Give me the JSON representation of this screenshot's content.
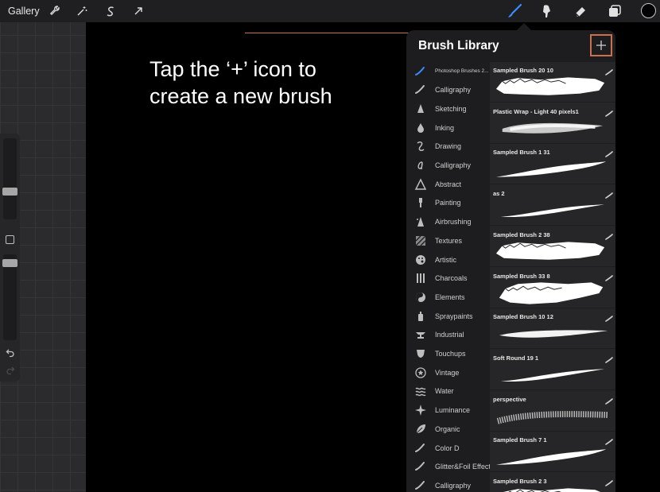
{
  "toolbar": {
    "gallery_label": "Gallery",
    "left_tools": [
      {
        "icon": "wrench-icon"
      },
      {
        "icon": "magic-wand-icon"
      },
      {
        "icon": "selection-icon"
      },
      {
        "icon": "transform-arrow-icon"
      }
    ],
    "right_tools": [
      {
        "icon": "brush-icon",
        "active": true
      },
      {
        "icon": "smudge-icon"
      },
      {
        "icon": "eraser-icon"
      },
      {
        "icon": "layers-icon"
      }
    ],
    "accent_color": "#3a8dff",
    "current_color": "#000000"
  },
  "callout": {
    "text": "Tap the ‘+’ icon to\ncreate a new brush",
    "highlight_color": "#c8704f"
  },
  "brush_library": {
    "title": "Brush Library",
    "add_icon": "plus-icon",
    "categories": [
      {
        "label": "Photoshop Brushes 2...",
        "icon": "brush-stroke-icon",
        "selected": true
      },
      {
        "label": "Calligraphy",
        "icon": "brush-stroke-icon"
      },
      {
        "label": "Sketching",
        "icon": "pencil-tip-icon"
      },
      {
        "label": "Inking",
        "icon": "ink-drop-icon"
      },
      {
        "label": "Drawing",
        "icon": "squiggle-icon"
      },
      {
        "label": "Calligraphy",
        "icon": "script-a-icon"
      },
      {
        "label": "Abstract",
        "icon": "triangle-icon"
      },
      {
        "label": "Painting",
        "icon": "paintbrush-icon"
      },
      {
        "label": "Airbrushing",
        "icon": "airbrush-icon"
      },
      {
        "label": "Textures",
        "icon": "hatch-icon"
      },
      {
        "label": "Artistic",
        "icon": "palette-icon"
      },
      {
        "label": "Charcoals",
        "icon": "charcoal-icon"
      },
      {
        "label": "Elements",
        "icon": "yin-yang-icon"
      },
      {
        "label": "Spraypaints",
        "icon": "spray-can-icon"
      },
      {
        "label": "Industrial",
        "icon": "anvil-icon"
      },
      {
        "label": "Touchups",
        "icon": "shield-icon"
      },
      {
        "label": "Vintage",
        "icon": "star-badge-icon"
      },
      {
        "label": "Water",
        "icon": "waves-icon"
      },
      {
        "label": "Luminance",
        "icon": "sparkle-icon"
      },
      {
        "label": "Organic",
        "icon": "leaf-icon"
      },
      {
        "label": "Color D",
        "icon": "brush-stroke-icon"
      },
      {
        "label": "Glitter&Foil Effects",
        "icon": "brush-stroke-icon"
      },
      {
        "label": "Calligraphy",
        "icon": "brush-stroke-icon"
      }
    ],
    "brushes": [
      {
        "name": "Sampled Brush 20 10",
        "stroke": "rough-wide"
      },
      {
        "name": "Plastic Wrap - Light 40 pixels1",
        "stroke": "soft-wide"
      },
      {
        "name": "Sampled Brush 1 31",
        "stroke": "tapered-rough"
      },
      {
        "name": "as 2",
        "stroke": "smooth-taper"
      },
      {
        "name": "Sampled Brush 2 38",
        "stroke": "rough-wide"
      },
      {
        "name": "Sampled Brush 33 8",
        "stroke": "rough-blob"
      },
      {
        "name": "Sampled Brush 10 12",
        "stroke": "soft-taper"
      },
      {
        "name": "Soft Round 19 1",
        "stroke": "smooth-taper"
      },
      {
        "name": "perspective",
        "stroke": "dotted"
      },
      {
        "name": "Sampled Brush 7 1",
        "stroke": "tapered-rough"
      },
      {
        "name": "Sampled Brush 2 3",
        "stroke": "rough-wide"
      }
    ]
  }
}
